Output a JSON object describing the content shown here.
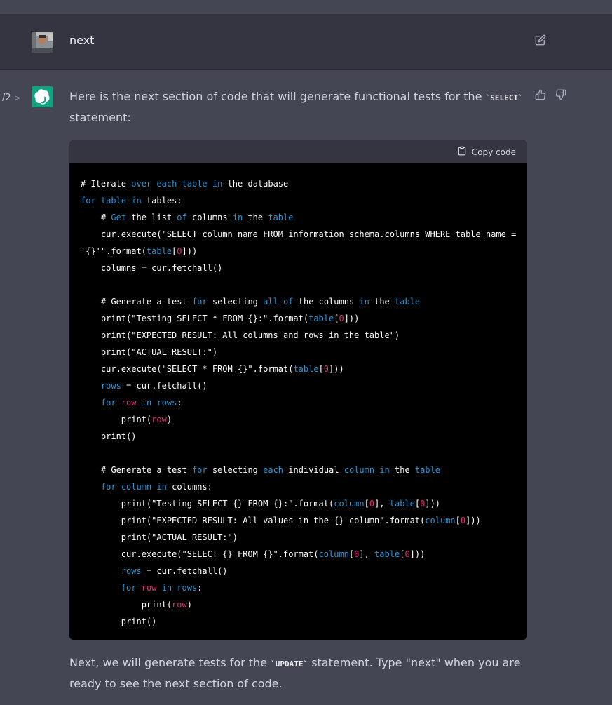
{
  "user_message": {
    "text": "next"
  },
  "assistant_message": {
    "pager": {
      "label": "/2",
      "chevron": ">"
    },
    "intro_before": "Here is the next section of code that will generate functional tests for the ",
    "intro_code": "`SELECT`",
    "intro_after": " statement:",
    "code_block": {
      "copy_label": "Copy code",
      "lines": [
        [
          {
            "t": "# Iterate ",
            "c": "plain"
          },
          {
            "t": "over",
            "c": "kw"
          },
          {
            "t": " ",
            "c": "plain"
          },
          {
            "t": "each",
            "c": "kw"
          },
          {
            "t": " ",
            "c": "plain"
          },
          {
            "t": "table",
            "c": "kw"
          },
          {
            "t": " ",
            "c": "plain"
          },
          {
            "t": "in",
            "c": "kw"
          },
          {
            "t": " the database",
            "c": "plain"
          }
        ],
        [
          {
            "t": "for",
            "c": "kw"
          },
          {
            "t": " ",
            "c": "plain"
          },
          {
            "t": "table",
            "c": "kw"
          },
          {
            "t": " ",
            "c": "plain"
          },
          {
            "t": "in",
            "c": "kw"
          },
          {
            "t": " tables:",
            "c": "plain"
          }
        ],
        [
          {
            "t": "    # ",
            "c": "plain"
          },
          {
            "t": "Get",
            "c": "kw"
          },
          {
            "t": " the list ",
            "c": "plain"
          },
          {
            "t": "of",
            "c": "kw"
          },
          {
            "t": " columns ",
            "c": "plain"
          },
          {
            "t": "in",
            "c": "kw"
          },
          {
            "t": " the ",
            "c": "plain"
          },
          {
            "t": "table",
            "c": "kw"
          }
        ],
        [
          {
            "t": "    cur.execute(\"SELECT column_name FROM information_schema.columns WHERE table_name =",
            "c": "plain"
          }
        ],
        [
          {
            "t": "'{}'\".format(",
            "c": "plain"
          },
          {
            "t": "table",
            "c": "kw"
          },
          {
            "t": "[",
            "c": "plain"
          },
          {
            "t": "0",
            "c": "red"
          },
          {
            "t": "]))",
            "c": "plain"
          }
        ],
        [
          {
            "t": "    columns = cur.fetchall()",
            "c": "plain"
          }
        ],
        [],
        [
          {
            "t": "    # Generate a test ",
            "c": "plain"
          },
          {
            "t": "for",
            "c": "kw"
          },
          {
            "t": " selecting ",
            "c": "plain"
          },
          {
            "t": "all",
            "c": "kw"
          },
          {
            "t": " ",
            "c": "plain"
          },
          {
            "t": "of",
            "c": "kw"
          },
          {
            "t": " the columns ",
            "c": "plain"
          },
          {
            "t": "in",
            "c": "kw"
          },
          {
            "t": " the ",
            "c": "plain"
          },
          {
            "t": "table",
            "c": "kw"
          }
        ],
        [
          {
            "t": "    print(\"Testing SELECT * FROM {}:\".format(",
            "c": "plain"
          },
          {
            "t": "table",
            "c": "kw"
          },
          {
            "t": "[",
            "c": "plain"
          },
          {
            "t": "0",
            "c": "red"
          },
          {
            "t": "]))",
            "c": "plain"
          }
        ],
        [
          {
            "t": "    print(\"EXPECTED RESULT: All columns and rows in the table\")",
            "c": "plain"
          }
        ],
        [
          {
            "t": "    print(\"ACTUAL RESULT:\")",
            "c": "plain"
          }
        ],
        [
          {
            "t": "    cur.execute(\"SELECT * FROM {}\".format(",
            "c": "plain"
          },
          {
            "t": "table",
            "c": "kw"
          },
          {
            "t": "[",
            "c": "plain"
          },
          {
            "t": "0",
            "c": "red"
          },
          {
            "t": "]))",
            "c": "plain"
          }
        ],
        [
          {
            "t": "    ",
            "c": "plain"
          },
          {
            "t": "rows",
            "c": "kw"
          },
          {
            "t": " = cur.fetchall()",
            "c": "plain"
          }
        ],
        [
          {
            "t": "    ",
            "c": "plain"
          },
          {
            "t": "for",
            "c": "kw"
          },
          {
            "t": " ",
            "c": "plain"
          },
          {
            "t": "row",
            "c": "red"
          },
          {
            "t": " ",
            "c": "plain"
          },
          {
            "t": "in",
            "c": "kw"
          },
          {
            "t": " ",
            "c": "plain"
          },
          {
            "t": "rows",
            "c": "kw"
          },
          {
            "t": ":",
            "c": "plain"
          }
        ],
        [
          {
            "t": "        print(",
            "c": "plain"
          },
          {
            "t": "row",
            "c": "red"
          },
          {
            "t": ")",
            "c": "plain"
          }
        ],
        [
          {
            "t": "    print()",
            "c": "plain"
          }
        ],
        [],
        [
          {
            "t": "    # Generate a test ",
            "c": "plain"
          },
          {
            "t": "for",
            "c": "kw"
          },
          {
            "t": " selecting ",
            "c": "plain"
          },
          {
            "t": "each",
            "c": "kw"
          },
          {
            "t": " individual ",
            "c": "plain"
          },
          {
            "t": "column",
            "c": "kw"
          },
          {
            "t": " ",
            "c": "plain"
          },
          {
            "t": "in",
            "c": "kw"
          },
          {
            "t": " the ",
            "c": "plain"
          },
          {
            "t": "table",
            "c": "kw"
          }
        ],
        [
          {
            "t": "    ",
            "c": "plain"
          },
          {
            "t": "for",
            "c": "kw"
          },
          {
            "t": " ",
            "c": "plain"
          },
          {
            "t": "column",
            "c": "kw"
          },
          {
            "t": " ",
            "c": "plain"
          },
          {
            "t": "in",
            "c": "kw"
          },
          {
            "t": " columns:",
            "c": "plain"
          }
        ],
        [
          {
            "t": "        print(\"Testing SELECT {} FROM {}:\".format(",
            "c": "plain"
          },
          {
            "t": "column",
            "c": "kw"
          },
          {
            "t": "[",
            "c": "plain"
          },
          {
            "t": "0",
            "c": "red"
          },
          {
            "t": "], ",
            "c": "plain"
          },
          {
            "t": "table",
            "c": "kw"
          },
          {
            "t": "[",
            "c": "plain"
          },
          {
            "t": "0",
            "c": "red"
          },
          {
            "t": "]))",
            "c": "plain"
          }
        ],
        [
          {
            "t": "        print(\"EXPECTED RESULT: All values in the {} column\".format(",
            "c": "plain"
          },
          {
            "t": "column",
            "c": "kw"
          },
          {
            "t": "[",
            "c": "plain"
          },
          {
            "t": "0",
            "c": "red"
          },
          {
            "t": "]))",
            "c": "plain"
          }
        ],
        [
          {
            "t": "        print(\"ACTUAL RESULT:\")",
            "c": "plain"
          }
        ],
        [
          {
            "t": "        cur.execute(\"SELECT {} FROM {}\".format(",
            "c": "plain"
          },
          {
            "t": "column",
            "c": "kw"
          },
          {
            "t": "[",
            "c": "plain"
          },
          {
            "t": "0",
            "c": "red"
          },
          {
            "t": "], ",
            "c": "plain"
          },
          {
            "t": "table",
            "c": "kw"
          },
          {
            "t": "[",
            "c": "plain"
          },
          {
            "t": "0",
            "c": "red"
          },
          {
            "t": "]))",
            "c": "plain"
          }
        ],
        [
          {
            "t": "        ",
            "c": "plain"
          },
          {
            "t": "rows",
            "c": "kw"
          },
          {
            "t": " = cur.fetchall()",
            "c": "plain"
          }
        ],
        [
          {
            "t": "        ",
            "c": "plain"
          },
          {
            "t": "for",
            "c": "kw"
          },
          {
            "t": " ",
            "c": "plain"
          },
          {
            "t": "row",
            "c": "red"
          },
          {
            "t": " ",
            "c": "plain"
          },
          {
            "t": "in",
            "c": "kw"
          },
          {
            "t": " ",
            "c": "plain"
          },
          {
            "t": "rows",
            "c": "kw"
          },
          {
            "t": ":",
            "c": "plain"
          }
        ],
        [
          {
            "t": "            print(",
            "c": "plain"
          },
          {
            "t": "row",
            "c": "red"
          },
          {
            "t": ")",
            "c": "plain"
          }
        ],
        [
          {
            "t": "        print()",
            "c": "plain"
          }
        ]
      ]
    },
    "outro_before": "Next, we will generate tests for the ",
    "outro_code": "`UPDATE`",
    "outro_after": " statement. Type \"next\" when you are ready to see the next section of code."
  },
  "colors": {
    "assistant_bg": "#444654",
    "user_bg": "#343541",
    "code_bg": "#000000",
    "code_header_bg": "#343541",
    "keyword": "#2e95d3",
    "number_var": "#df3079",
    "brand_green": "#10a37f"
  },
  "icons": {
    "edit": "edit-icon",
    "thumbs_up": "thumbs-up-icon",
    "thumbs_down": "thumbs-down-icon",
    "clipboard": "clipboard-icon",
    "chatgpt_logo": "openai-logo-icon",
    "user_avatar": "user-avatar"
  }
}
